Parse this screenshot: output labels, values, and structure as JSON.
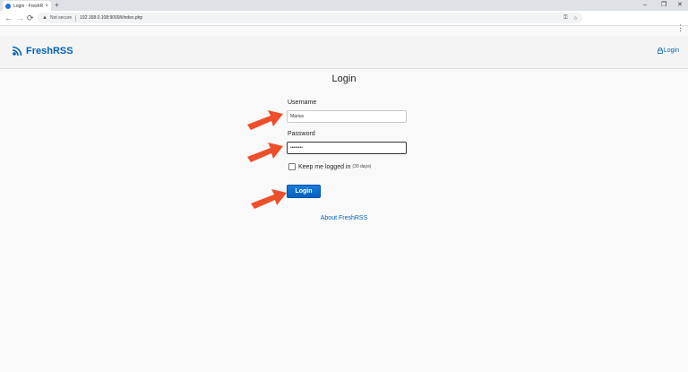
{
  "browser": {
    "tab_title": "Login · FreshR",
    "tab_close": "×",
    "new_tab": "+",
    "window_controls": {
      "minimize": "–",
      "restore": "❐",
      "close": "✕"
    },
    "nav": {
      "back": "←",
      "forward": "→",
      "reload": "⟳"
    },
    "security_label": "Not secure",
    "url": "192.168.0.108:9009/i/index.php",
    "menu": "⋮"
  },
  "header": {
    "logo_text": "FreshRSS",
    "login_link": "Login"
  },
  "form": {
    "title": "Login",
    "username_label": "Username",
    "username_value": "Marius",
    "password_label": "Password",
    "password_value": "••••••••",
    "keep_logged_label": "Keep me logged in",
    "keep_logged_hint": "(30 days)",
    "keep_logged_checked": false,
    "submit_label": "Login"
  },
  "footer": {
    "about_link": "About FreshRSS"
  },
  "colors": {
    "accent": "#0062be",
    "arrow": "#ee4e2a"
  }
}
